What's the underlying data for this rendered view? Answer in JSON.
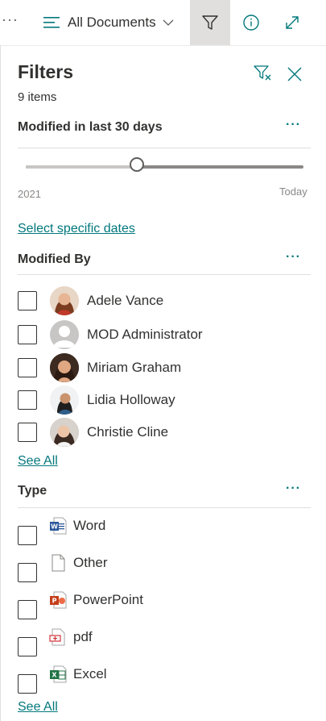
{
  "toolbar": {
    "more_icon": "ellipsis-icon",
    "view_label": "All Documents",
    "view_icon": "list-view-icon",
    "filter_icon": "filter-icon",
    "info_icon": "info-icon",
    "expand_icon": "expand-icon"
  },
  "panel": {
    "title": "Filters",
    "item_count": "9 items",
    "clear_icon": "clear-filter-icon",
    "close_icon": "close-icon"
  },
  "modified": {
    "title": "Modified in last 30 days",
    "more": "···",
    "slider_min_label": "2021",
    "slider_max_label": "Today",
    "slider_value_fraction": 0.4,
    "select_dates_link": "Select specific dates"
  },
  "modified_by": {
    "title": "Modified By",
    "more": "···",
    "people": [
      {
        "name": "Adele Vance",
        "checked": false
      },
      {
        "name": "MOD Administrator",
        "checked": false
      },
      {
        "name": "Miriam Graham",
        "checked": false
      },
      {
        "name": "Lidia Holloway",
        "checked": false
      },
      {
        "name": "Christie Cline",
        "checked": false
      }
    ],
    "see_all": "See All"
  },
  "type": {
    "title": "Type",
    "more": "···",
    "items": [
      {
        "label": "Word",
        "icon": "word-icon",
        "checked": false
      },
      {
        "label": "Other",
        "icon": "generic-file-icon",
        "checked": false
      },
      {
        "label": "PowerPoint",
        "icon": "powerpoint-icon",
        "checked": false
      },
      {
        "label": "pdf",
        "icon": "pdf-icon",
        "checked": false
      },
      {
        "label": "Excel",
        "icon": "excel-icon",
        "checked": false
      }
    ],
    "see_all": "See All"
  },
  "colors": {
    "accent": "#03787c",
    "word": "#2b579a",
    "powerpoint": "#c43e1c",
    "pdf": "#d13438",
    "excel": "#217346"
  }
}
